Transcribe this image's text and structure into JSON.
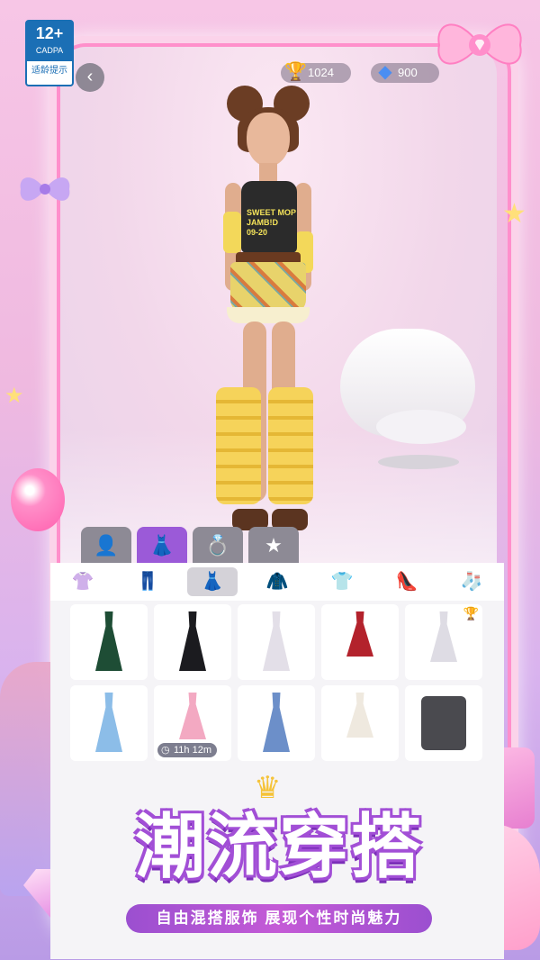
{
  "age_badge": {
    "rating": "12+",
    "org": "CADPA",
    "label": "适龄提示"
  },
  "header": {
    "back_icon": "‹",
    "trophies": "1024",
    "gems": "900"
  },
  "model": {
    "shirt_text": "SWEET MOP\nJAMB!D\n09-20"
  },
  "category_tabs": [
    {
      "name": "face",
      "icon": "👤"
    },
    {
      "name": "clothing",
      "icon": "👗"
    },
    {
      "name": "accessory",
      "icon": "💍"
    },
    {
      "name": "effects",
      "icon": "★"
    }
  ],
  "sub_tabs": [
    {
      "name": "tops",
      "icon": "👚"
    },
    {
      "name": "pants",
      "icon": "👖"
    },
    {
      "name": "dresses",
      "icon": "👗"
    },
    {
      "name": "jackets",
      "icon": "🧥"
    },
    {
      "name": "outerwear",
      "icon": "👕"
    },
    {
      "name": "shoes",
      "icon": "👠"
    },
    {
      "name": "socks",
      "icon": "🧦"
    }
  ],
  "items": [
    {
      "name": "green-gown",
      "color": "#1e4d35"
    },
    {
      "name": "black-bow-gown",
      "color": "#1b1b1f"
    },
    {
      "name": "white-mermaid-gown",
      "color": "#f1eef3"
    },
    {
      "name": "red-mini-dress",
      "color": "#b3222c"
    },
    {
      "name": "white-draped-dress",
      "color": "#e9e8ee",
      "trophy": true
    },
    {
      "name": "blue-ball-gown",
      "color": "#8cbde8"
    },
    {
      "name": "pink-ruffle-gown",
      "color": "#f3a9c2",
      "timer": "11h 12m"
    },
    {
      "name": "blue-cutout-dress",
      "color": "#6c8fc9"
    },
    {
      "name": "white-star-dress",
      "color": "#efe9df"
    },
    {
      "name": "grey-blazer",
      "color": "#4a4a4f"
    }
  ],
  "banner": {
    "title": "潮流穿搭",
    "subtitle": "自由混搭服饰 展现个性时尚魅力"
  },
  "colors": {
    "accent": "#9b5ad8",
    "frame": "#ff8fcb"
  }
}
